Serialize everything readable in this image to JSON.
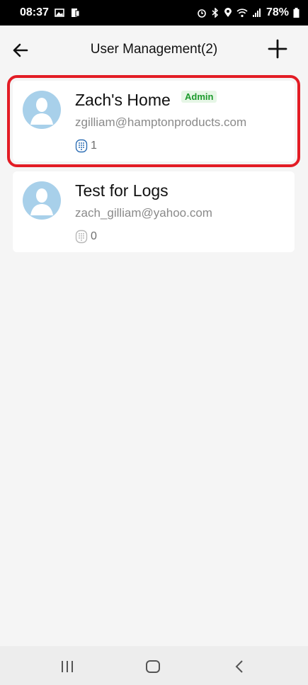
{
  "status_bar": {
    "time": "08:37",
    "battery": "78%",
    "icons_left": [
      "gallery-icon",
      "sim-icon"
    ],
    "icons_right": [
      "alarm-icon",
      "bluetooth-icon",
      "location-icon",
      "wifi-icon",
      "signal-icon",
      "battery-icon"
    ]
  },
  "header": {
    "back_icon": "arrow-left-icon",
    "title": "User Management(2)",
    "add_icon": "plus-icon"
  },
  "users": [
    {
      "name": "Zach's Home",
      "badge": "Admin",
      "email": "zgilliam@hamptonproducts.com",
      "device_count": "1",
      "selected": true
    },
    {
      "name": "Test for Logs",
      "badge": "",
      "email": "zach_gilliam@yahoo.com",
      "device_count": "0",
      "selected": false
    }
  ],
  "colors": {
    "highlight": "#e31c25",
    "admin_badge": "#1c9a2c",
    "avatar_bg": "#a8d0ea",
    "keypad_active": "#2f6fb5",
    "keypad_inactive": "#b8b8b8"
  },
  "nav_bar": {
    "icons": [
      "recent-apps-icon",
      "home-icon",
      "back-icon"
    ]
  }
}
